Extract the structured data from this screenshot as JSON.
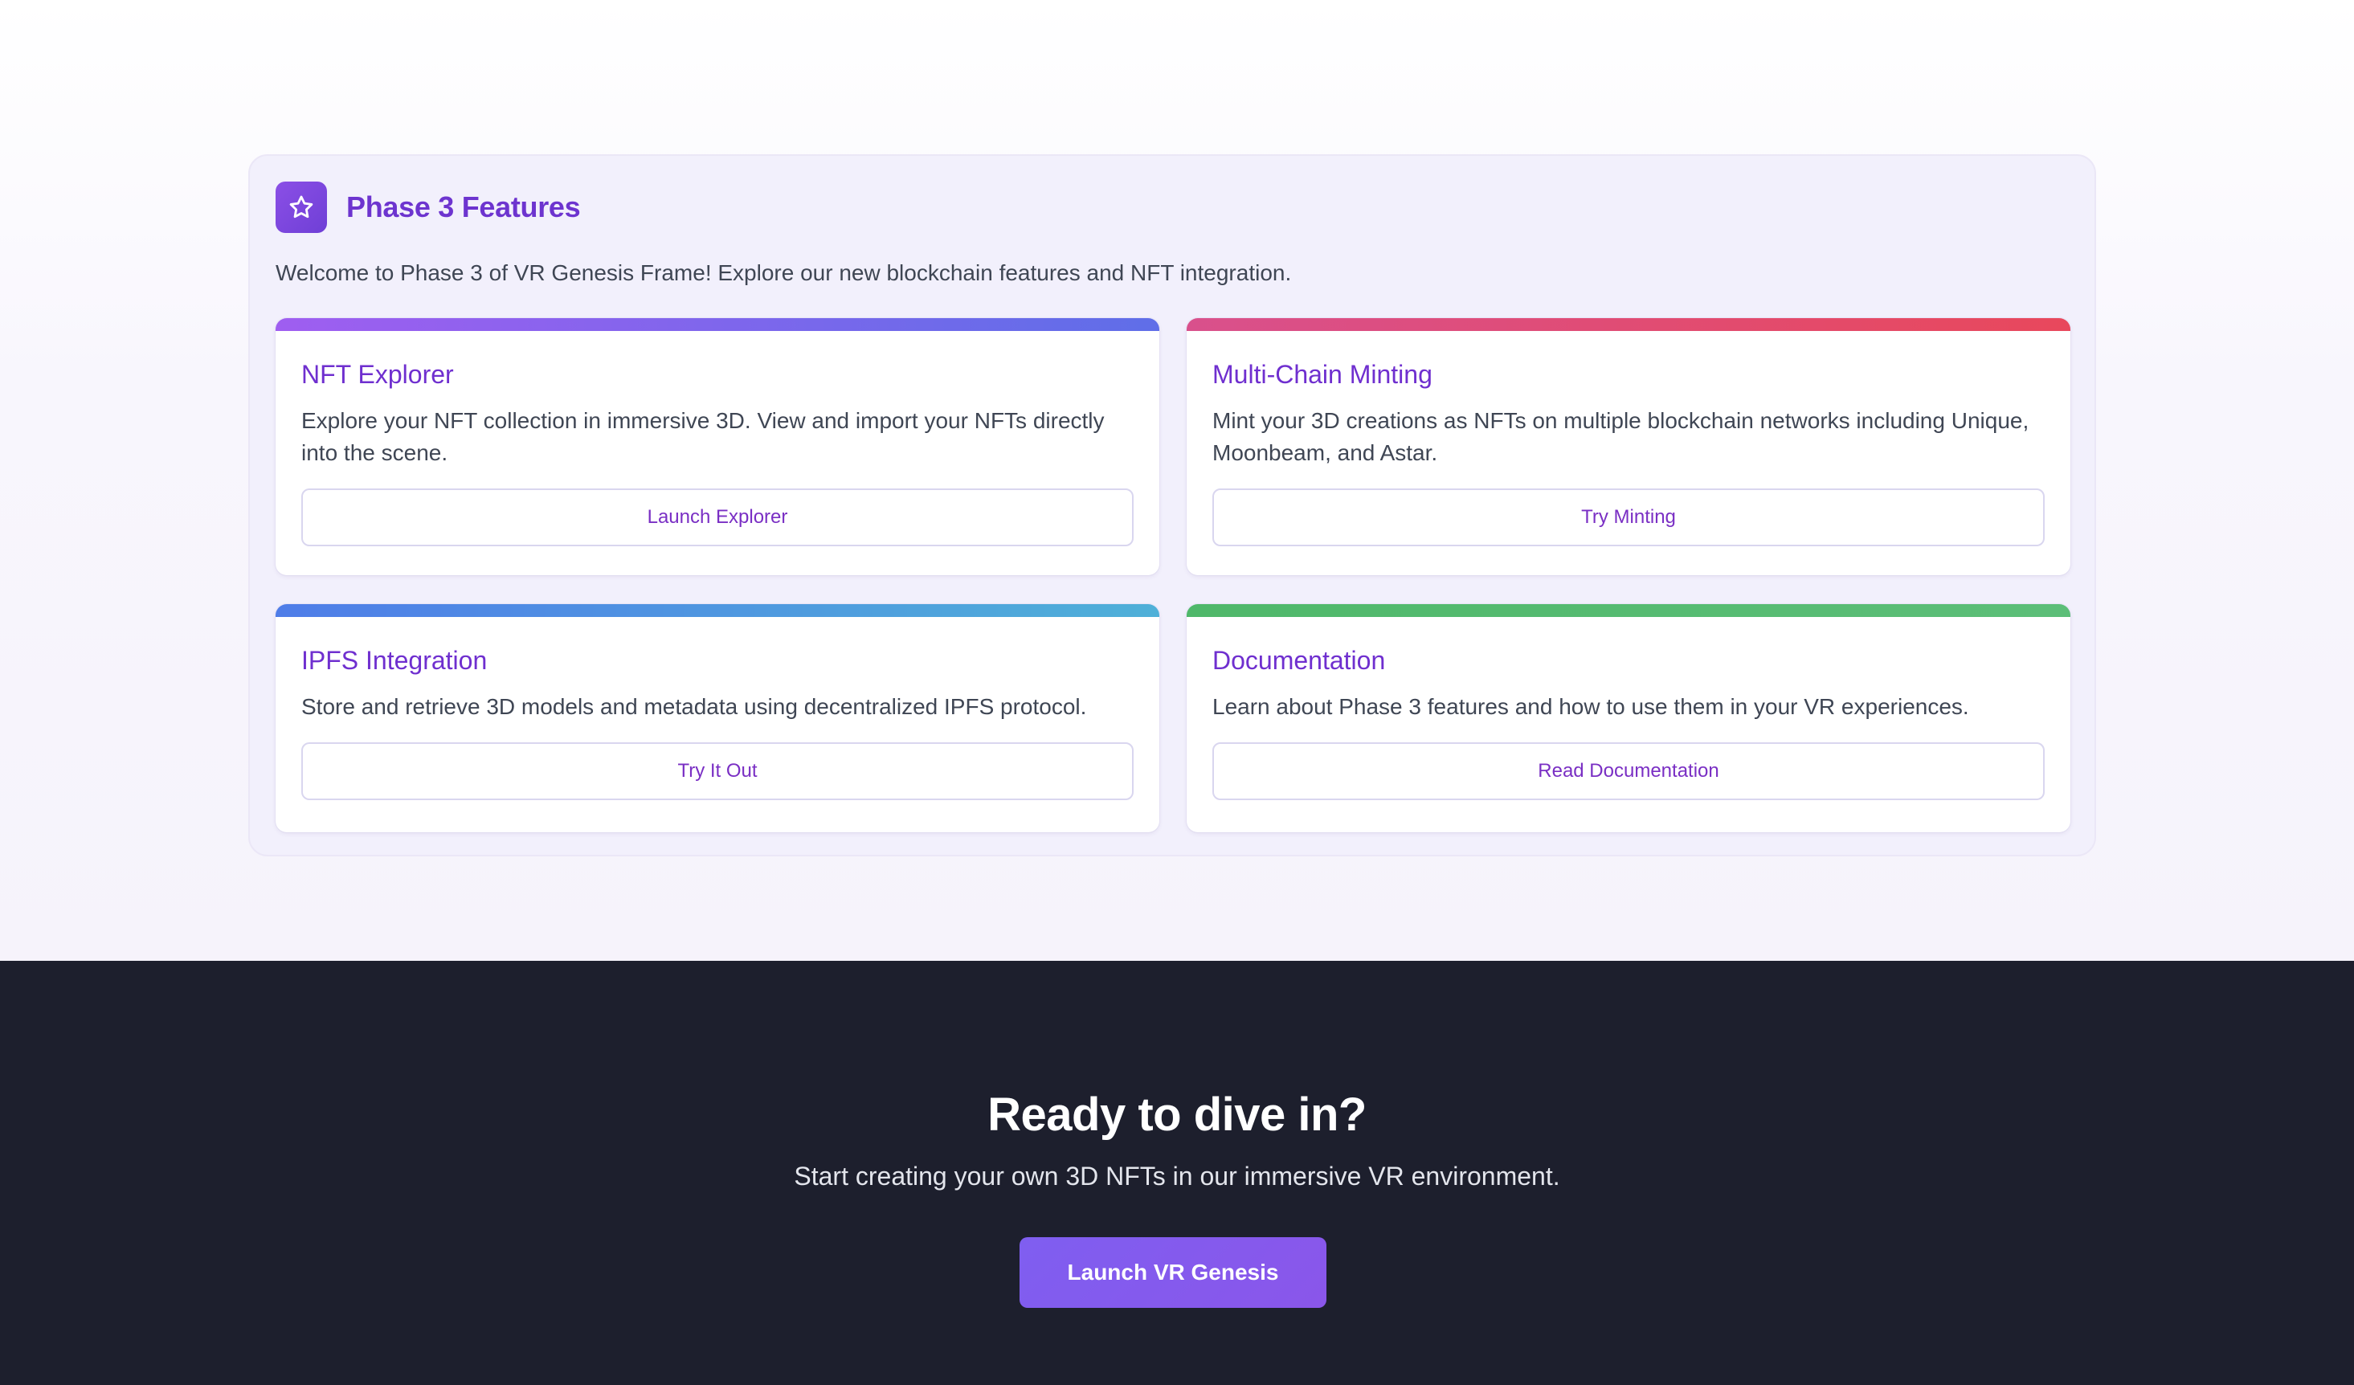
{
  "features": {
    "icon": "star-icon",
    "title": "Phase 3 Features",
    "intro": "Welcome to Phase 3 of VR Genesis Frame! Explore our new blockchain features and NFT integration.",
    "cards": [
      {
        "title": "NFT Explorer",
        "description": "Explore your NFT collection in immersive 3D. View and import your NFTs directly into the scene.",
        "button": "Launch Explorer",
        "accent": [
          "#9f5ef0",
          "#5f6ee8"
        ]
      },
      {
        "title": "Multi-Chain Minting",
        "description": "Mint your 3D creations as NFTs on multiple blockchain networks including Unique, Moonbeam, and Astar.",
        "button": "Try Minting",
        "accent": [
          "#d9508c",
          "#e8485c"
        ]
      },
      {
        "title": "IPFS Integration",
        "description": "Store and retrieve 3D models and metadata using decentralized IPFS protocol.",
        "button": "Try It Out",
        "accent": [
          "#4f7de8",
          "#4fb0d8"
        ]
      },
      {
        "title": "Documentation",
        "description": "Learn about Phase 3 features and how to use them in your VR experiences.",
        "button": "Read Documentation",
        "accent": [
          "#4fb86a",
          "#5cbe78"
        ]
      }
    ]
  },
  "cta": {
    "title": "Ready to dive in?",
    "subtitle": "Start creating your own 3D NFTs in our immersive VR environment.",
    "button": "Launch VR Genesis"
  },
  "colors": {
    "brand_purple": "#6d34cf",
    "cta_background": "#1d1f2d",
    "cta_button": "#8259ee"
  }
}
